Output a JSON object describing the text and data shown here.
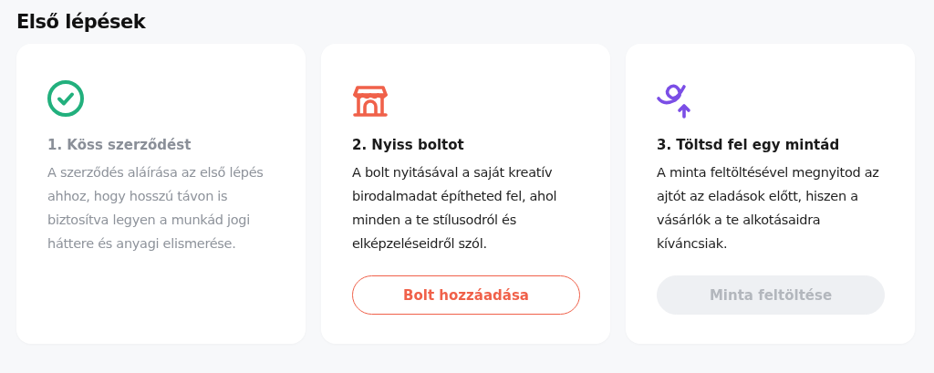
{
  "heading": "Első lépések",
  "steps": [
    {
      "kind": "check",
      "completed": true,
      "title": "1. Köss szerződést",
      "text": "A szerződés aláírása az első lépés ahhoz, hogy hosszú távon is biztosítva legyen a munkád jogi háttere és anyagi elismerése."
    },
    {
      "kind": "shop",
      "completed": false,
      "title": "2. Nyiss boltot",
      "text": "A bolt nyitásával a saját kreatív birodalmadat építheted fel, ahol minden a te stílusodról és elképzeléseidről szól.",
      "button": {
        "label": "Bolt hozzáadása",
        "disabled": false
      }
    },
    {
      "kind": "upload",
      "completed": false,
      "title": "3. Töltsd fel egy mintád",
      "text": "A minta feltöltésével megnyitod az ajtót az eladások előtt, hiszen a vásárlók a te alkotásaidra kíváncsiak.",
      "button": {
        "label": "Minta feltöltése",
        "disabled": true
      }
    }
  ]
}
